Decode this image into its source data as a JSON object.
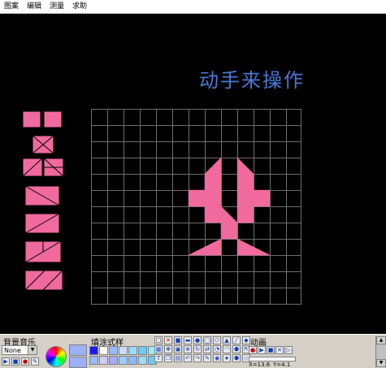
{
  "menu": [
    "图案",
    "编辑",
    "测量",
    "求助"
  ],
  "title": "动手来操作",
  "colors": {
    "pink": "#f06a9e",
    "title": "#4a78d8",
    "grid": "#6e6e6e",
    "panel": "#d4d0c8"
  },
  "bottom": {
    "bg_music_label": "背景音乐",
    "bg_music_value": "None",
    "fill_style_label": "填涂式样",
    "animation_label": "动画",
    "coord_x": "X=13.6",
    "coord_y": "Y=4.1"
  }
}
